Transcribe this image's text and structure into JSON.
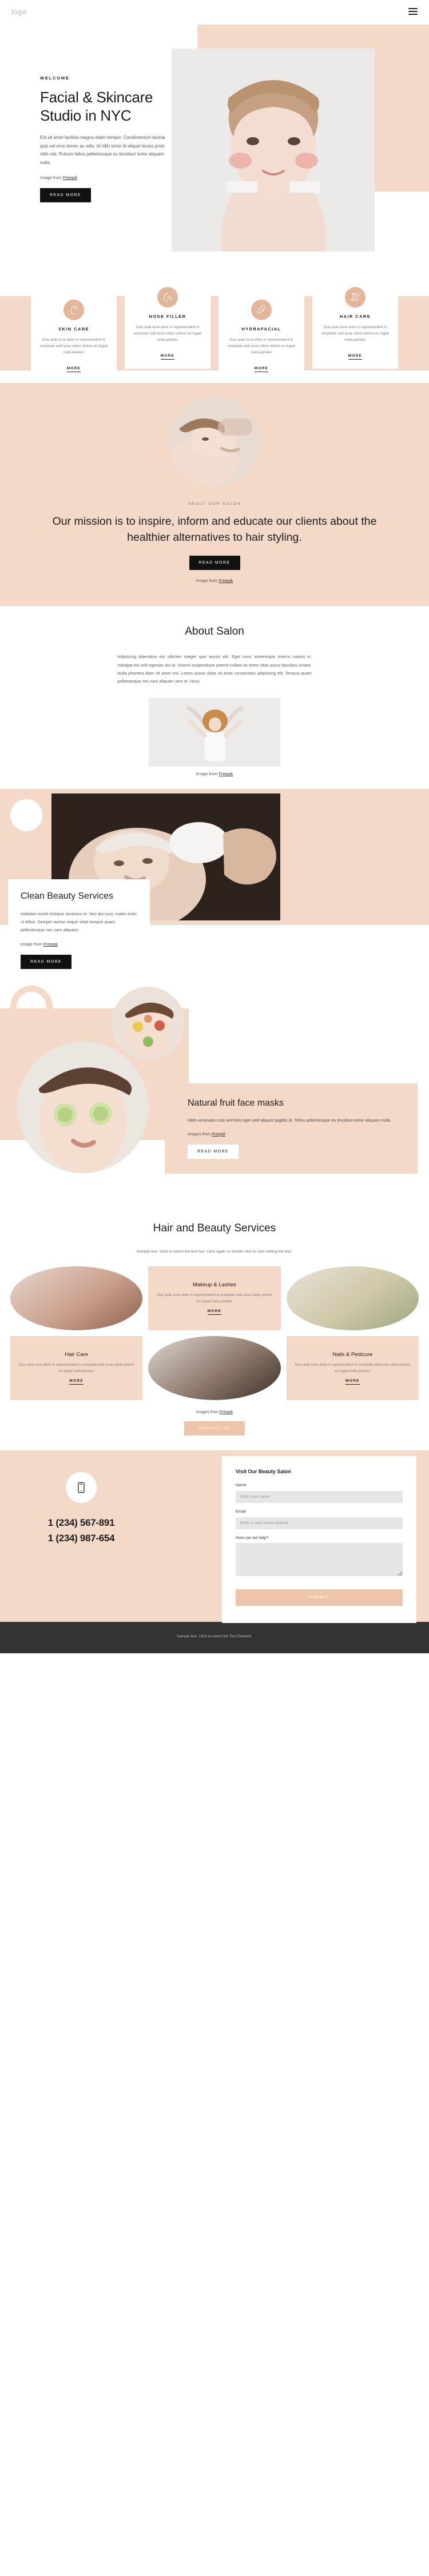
{
  "header": {
    "logo": "logo",
    "menu_label": "menu"
  },
  "hero": {
    "eyebrow": "WELCOME",
    "title": "Facial & Skincare Studio in NYC",
    "text": "Est sit amet facilisis magna etiam tempor. Condimentum lacinia quis vel eros donec ac odio. Id nibh tortor id aliquet lectus proin nibh nisl. Rutrum tellus pellentesque eu tincidunt tortor aliquam nulla.",
    "credit_prefix": "Image from ",
    "credit_link": "Freepik",
    "cta": "READ MORE"
  },
  "services": {
    "more_label": "MORE",
    "items": [
      {
        "icon": "face-profile-icon",
        "title": "SKIN CARE",
        "text": "Duis aute irure dolor in reprehenderit in voluptate velit esse cillum dolore eu fugiat nulla pariatur"
      },
      {
        "icon": "face-nose-icon",
        "title": "NOSE FILLER",
        "text": "Duis aute irure dolor in reprehenderit in voluptate velit esse cillum dolore eu fugiat nulla pariatur"
      },
      {
        "icon": "brush-icon",
        "title": "HYDRAFACIAL",
        "text": "Duis aute irure dolor in reprehenderit in voluptate velit esse cillum dolore eu fugiat nulla pariatur"
      },
      {
        "icon": "hair-icon",
        "title": "HAIR CARE",
        "text": "Duis aute irure dolor in reprehenderit in voluptate velit esse cillum dolore eu fugiat nulla pariatur"
      }
    ]
  },
  "mission": {
    "eyebrow": "ABOUT OUR SALON",
    "title": "Our mission is to inspire, inform and educate our clients about the healthier alternatives to hair styling.",
    "cta": "READ MORE",
    "credit_prefix": "Image from ",
    "credit_link": "Freepik"
  },
  "about": {
    "title": "About Salon",
    "text": "Adipiscing bibendum est ultricies integer quis auctor elit. Eget nunc scelerisque viverra mauris in. Volutpat est velit egestas dui id. Viverra suspendisse potenti nullam ac tortor vitae purus faucibus ornare. Nulla pharetra diam sit amet nisl. Lorem ipsum dolor sit amet consectetur adipiscing elit. Tempus quam pellentesque nec nam aliquam sem et. Nunc",
    "credit_prefix": "Image from ",
    "credit_link": "Freepik"
  },
  "clean": {
    "title": "Clean Beauty Services",
    "text": "Habitant morbi tristique senectus et. Nec dui nunc mattis enim ut tellus. Semper auctor neque vitae tempus quam pellentesque nec nam aliquam.",
    "credit_prefix": "Image from ",
    "credit_link": "Freepik",
    "cta": "READ MORE"
  },
  "fruit": {
    "title": "Natural fruit face masks",
    "text": "Nibh venenatis cras sed felis eget velit aliquet sagittis id. Tellus pellentesque eu tincidunt tortor aliquam nulla.",
    "credit_prefix": "Images from ",
    "credit_link": "Freepik",
    "cta": "READ MORE"
  },
  "grid": {
    "title": "Hair and Beauty Services",
    "subtitle": "Sample text. Click to select the text box. Click again or double click to start editing the text.",
    "more_label": "MORE",
    "credit_prefix": "Images from ",
    "credit_link": "Freepik",
    "cta": "CONTACT US",
    "cells": [
      {
        "kind": "photo",
        "variant": "a",
        "name": "makeup-brushes-photo"
      },
      {
        "kind": "text",
        "title": "Makeup & Lashes",
        "text": "Duis aute irure dolor in reprehenderit in voluptate velit esse cillum dolore eu fugiat nulla pariatur"
      },
      {
        "kind": "photo",
        "variant": "b",
        "name": "nail-care-photo"
      },
      {
        "kind": "text",
        "title": "Hair Care",
        "text": "Duis aute irure dolor in reprehenderit in voluptate velit esse cillum dolore eu fugiat nulla pariatur"
      },
      {
        "kind": "photo",
        "variant": "c",
        "name": "hair-styling-photo"
      },
      {
        "kind": "text",
        "title": "Nails & Pedicure",
        "text": "Duis aute irure dolor in reprehenderit in voluptate velit esse cillum dolore eu fugiat nulla pariatur"
      }
    ]
  },
  "contact": {
    "heading": "Visit Our Beauty Salon",
    "name_label": "Name",
    "name_placeholder": "Enter your name",
    "email_label": "Email",
    "email_placeholder": "Enter a valid email address",
    "message_label": "How can we help?",
    "message_placeholder": "",
    "submit": "SUBMIT",
    "phone_1": "1 (234) 567-891",
    "phone_2": "1 (234) 987-654"
  },
  "footer": {
    "text": "Sample text. Click to select the Text Element."
  },
  "colors": {
    "peach": "#f4d8c8",
    "peach_dark": "#e3b69c",
    "accent": "#eec4ac",
    "dark": "#111111",
    "footer": "#333333"
  }
}
